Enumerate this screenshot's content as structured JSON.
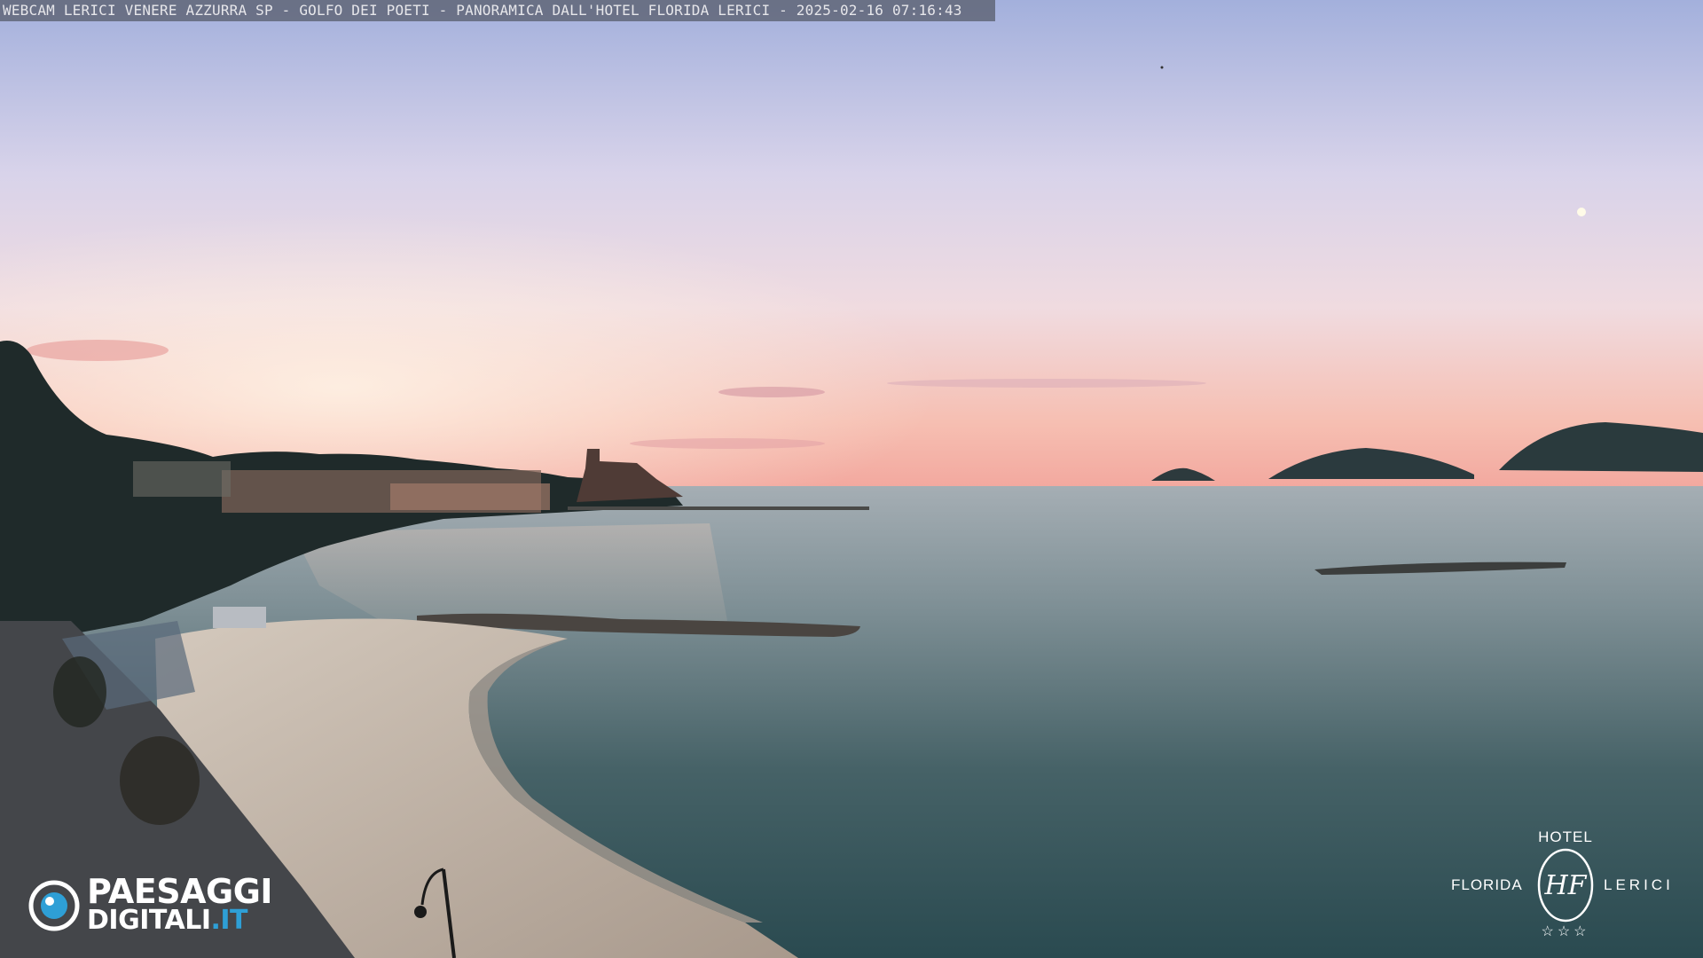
{
  "caption": {
    "text": "WEBCAM LERICI VENERE AZZURRA SP - GOLFO DEI POETI - PANORAMICA DALL'HOTEL FLORIDA LERICI - 2025-02-16 07:16:43"
  },
  "logo_left": {
    "line1": "PAESAGGI",
    "line2_main": "DIGITALI",
    "line2_tld": ".IT",
    "icon": "eye-icon",
    "accent_color": "#2e9fd6"
  },
  "logo_right": {
    "top": "HOTEL",
    "left": "FLORIDA",
    "right": "LERICI",
    "stars": "☆☆☆",
    "monogram": "HF"
  },
  "colors": {
    "sky_top": "#a7b4de",
    "sky_mid": "#e8dbe8",
    "sky_horizon": "#f5b3a4",
    "sea_far": "#8e9ea6",
    "sea_near": "#2f5258",
    "beach": "#c9bdb0"
  }
}
